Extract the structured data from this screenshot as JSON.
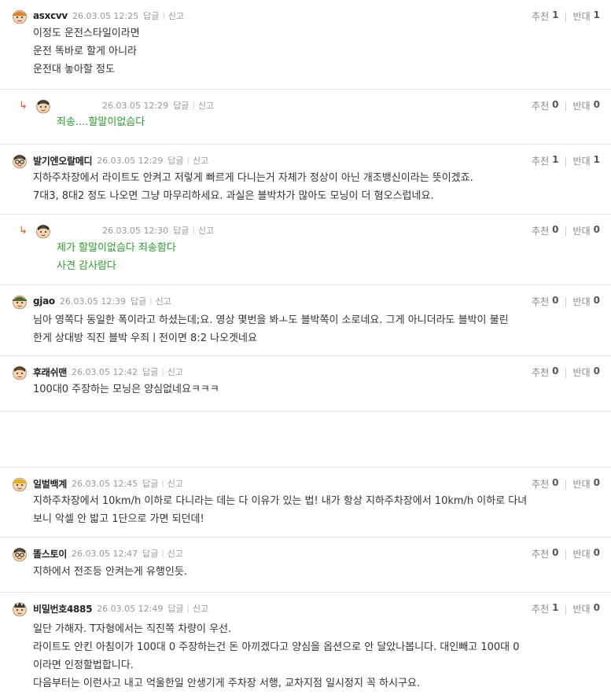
{
  "labels": {
    "reply": "답글",
    "report": "신고",
    "up": "추천",
    "down": "반대"
  },
  "comments": [
    {
      "nick": "asxcvv",
      "date": "26.03.05 12:25",
      "up": "1",
      "down": "1",
      "lines": [
        "이정도 운전스타일이라면",
        "운전 똑바로 할게 아니라",
        "운전대 놓아할 정도"
      ]
    },
    {
      "nick": "",
      "date": "26.03.05 12:29",
      "up": "0",
      "down": "0",
      "lines": [
        "죄송....할말이없슴다"
      ]
    },
    {
      "nick": "발기엔오랄메디",
      "date": "26.03.05 12:29",
      "up": "1",
      "down": "1",
      "lines": [
        "지하주차장에서 라이트도 안켜고 저렇게 빠르게 다니는거 자체가 정상이 아닌 개조뱅신이라는 뜻이겠죠.",
        "7대3, 8대2 정도 나오면 그냥 마무리하세요. 과실은 블박차가 많아도 모닝이 더 혐오스럽네요."
      ]
    },
    {
      "nick": "",
      "date": "26.03.05 12:30",
      "up": "0",
      "down": "0",
      "lines": [
        "제가 할말이없슴다 죄송함다",
        "사견 감사람다"
      ]
    },
    {
      "nick": "gjao",
      "date": "26.03.05 12:39",
      "up": "0",
      "down": "0",
      "lines": [
        "님아 영쪽다 동일한 폭이라고 하셨는데;요. 영상 몇번을 봐ㅗ도 블박쪽이 소로네요. 그게 아니더라도 블박이 불린",
        "한게 상대방 직진 블박 우죄ㅣ전이면 8:2 나오겟네요"
      ]
    },
    {
      "nick": "후래쉬맨",
      "date": "26.03.05 12:42",
      "up": "0",
      "down": "0",
      "lines": [
        "100대0 주장하는 모닝은 양심없네요ㅋㅋㅋ"
      ]
    },
    {
      "nick": "일벌백계",
      "date": "26.03.05 12:45",
      "up": "0",
      "down": "0",
      "lines": [
        "지하주차장에서 10km/h 이하로 다니라는 데는 다 이유가 있는 법! 내가 항상 지하주차장에서 10km/h 이하로 다녀",
        "보니 악셀 안 밟고 1단으로 가면 되던데!"
      ]
    },
    {
      "nick": "똘스토이",
      "date": "26.03.05 12:47",
      "up": "0",
      "down": "0",
      "lines": [
        "지하에서 전조등 안켜는게 유행인듯."
      ]
    },
    {
      "nick": "비밀번호4885",
      "date": "26.03.05 12:49",
      "up": "1",
      "down": "0",
      "lines": [
        "일단 가해자. T자형에서는 직진쪽 차량이 우선.",
        "라이트도 안킨 아침이가 100대 0 주장하는건 돈 아끼겠다고 양심을 옵션으로 안 달았나봅니다. 대인빼고 100대 0",
        "이라면 인정할법합니다.",
        "다음부터는 이런사고 내고 억울한일 안생기게 주차장 서행, 교차지점 일시정지 꼭 하시구요."
      ]
    }
  ],
  "avatars": [
    {
      "icon": "face-cap-orange-icon",
      "color": "#d9822b"
    },
    {
      "icon": "face-black-hair-icon",
      "color": "#222222"
    },
    {
      "icon": "face-glasses-icon",
      "color": "#2b2b2b"
    },
    {
      "icon": "face-black-hair-icon",
      "color": "#222222"
    },
    {
      "icon": "face-army-helmet-icon",
      "color": "#4f6b2f"
    },
    {
      "icon": "face-black-hair-icon",
      "color": "#3a2a1a"
    },
    {
      "icon": "face-yellow-hat-icon",
      "color": "#e0b21d"
    },
    {
      "icon": "face-glasses-icon",
      "color": "#2b2b2b"
    },
    {
      "icon": "face-spiky-hair-icon",
      "color": "#3a3a3a"
    }
  ],
  "colors": {
    "reply_text": "#2a9d2a",
    "reply_arrow": "#e25c2c"
  }
}
